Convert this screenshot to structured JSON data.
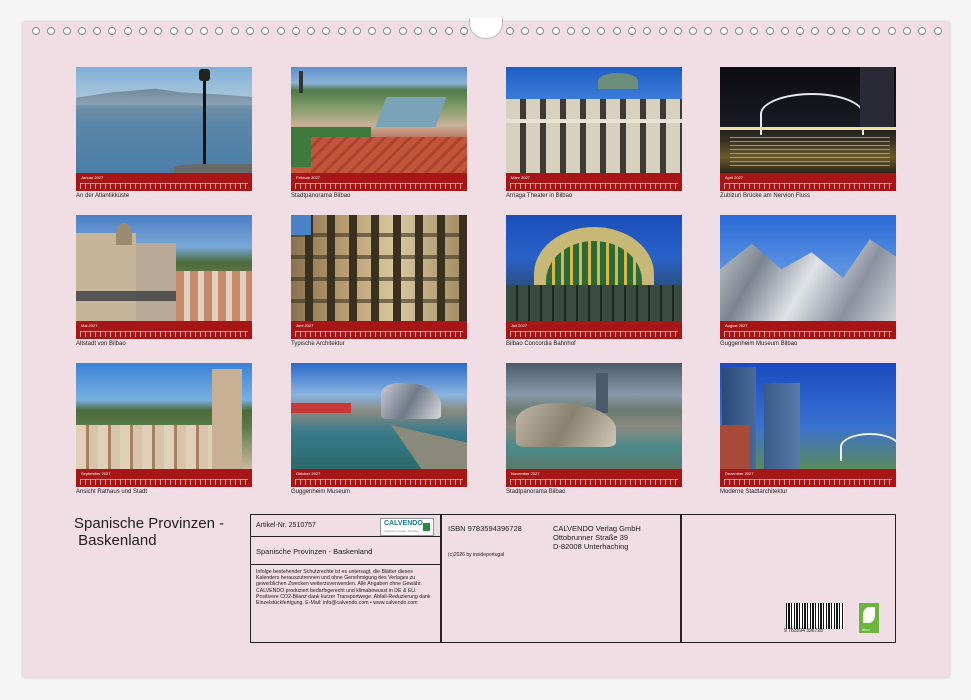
{
  "months": [
    {
      "label": "Januar 2027",
      "caption": "An der Atlantikküste"
    },
    {
      "label": "Februar 2027",
      "caption": "Stadtpanorama Bilbao"
    },
    {
      "label": "März 2027",
      "caption": "Arriaga Theater in Bilbao"
    },
    {
      "label": "April 2027",
      "caption": "Zubizuri Brücke am Nervion Fluss"
    },
    {
      "label": "Mai 2027",
      "caption": "Altstadt von Bilbao"
    },
    {
      "label": "Juni 2027",
      "caption": "Typische Architektur"
    },
    {
      "label": "Juli 2027",
      "caption": "Bilbao Concordia Bahnhof"
    },
    {
      "label": "August 2027",
      "caption": "Guggenheim Museum Bilbao"
    },
    {
      "label": "September 2027",
      "caption": "Ansicht Rathaus und Stadt"
    },
    {
      "label": "Oktober 2027",
      "caption": "Guggenheim Museum"
    },
    {
      "label": "November 2027",
      "caption": "Stadtpanorama Bilbao"
    },
    {
      "label": "Dezember 2027",
      "caption": "Moderne Stadtarchitektur"
    }
  ],
  "title_line1": "Spanische Provinzen -",
  "title_line2": " Baskenland",
  "info": {
    "article": "Artikel-Nr. 2510757",
    "calendar_title": "Spanische Provinzen - Baskenland",
    "legal": "Infolge bestehender Schutzrechte ist es untersagt, die Blätter dieses Kalenders herauszutrennen und ohne Genehmigung des Verlages zu gewerblichen Zwecken weiterzuverwenden. Alle Angaben ohne Gewähr. CALVENDO produziert bedarfsgerecht und klimabewusst in DE & EU. Positivere CO2-Bilanz dank kurzer Transportwege. Abfall-Reduzierung dank Einzelstückfertigung. E-Mail: info@calvendo.com • www.calvendo.com",
    "isbn": "ISBN 9783594396728",
    "copyright": "(c)2026 by insideportugal",
    "publisher_name": "CALVENDO Verlag GmbH",
    "publisher_street": "Ottobrunner Straße 39",
    "publisher_city": "D-82008 Unterhaching",
    "logo_name": "CALVENDO",
    "logo_tag": "Kalender, Poster, Puzzles",
    "barcode_number": "9 783594 396728",
    "feco_label": "feco"
  }
}
